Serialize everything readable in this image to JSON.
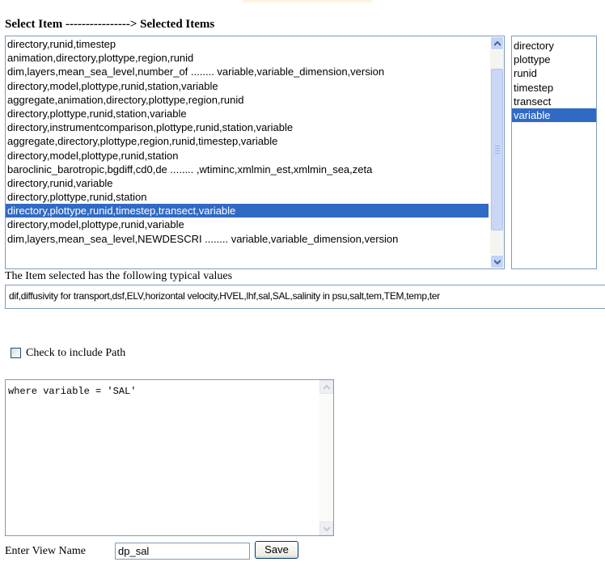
{
  "heading": "Select Item ----------------> Selected Items",
  "left_list": {
    "items": [
      "directory,runid,timestep",
      "animation,directory,plottype,region,runid",
      "dim,layers,mean_sea_level,number_of ........ variable,variable_dimension,version",
      "directory,model,plottype,runid,station,variable",
      "aggregate,animation,directory,plottype,region,runid",
      "directory,plottype,runid,station,variable",
      "directory,instrumentcomparison,plottype,runid,station,variable",
      "aggregate,directory,plottype,region,runid,timestep,variable",
      "directory,model,plottype,runid,station",
      "baroclinic_barotropic,bgdiff,cd0,de ........ ,wtiminc,xmlmin_est,xmlmin_sea,zeta",
      "directory,runid,variable",
      "directory,plottype,runid,station",
      "directory,plottype,runid,timestep,transect,variable",
      "directory,model,plottype,runid,variable",
      "dim,layers,mean_sea_level,NEWDESCRI ........ variable,variable_dimension,version"
    ],
    "selected_index": 12
  },
  "right_list": {
    "items": [
      "directory",
      "plottype",
      "runid",
      "timestep",
      "transect",
      "variable"
    ],
    "selected_index": 5
  },
  "values_label": "The Item selected has the following typical values",
  "values_text": "dif,diffusivity for transport,dsf,ELV,horizontal velocity,HVEL,lhf,sal,SAL,salinity in psu,salt,tem,TEM,temp,ter",
  "checkbox": {
    "label": "Check to include Path",
    "checked": false
  },
  "query_text": "where variable = 'SAL'",
  "view_name": {
    "label": "Enter View Name",
    "value": "dp_sal"
  },
  "save_label": "Save",
  "colors": {
    "selection": "#316ac5",
    "border": "#7f9db9"
  }
}
